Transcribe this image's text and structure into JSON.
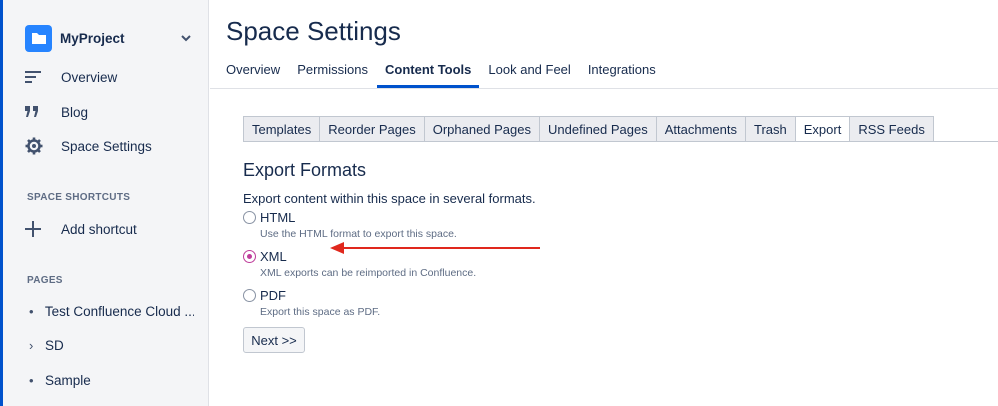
{
  "sidebar": {
    "project_name": "MyProject",
    "nav": [
      {
        "label": "Overview",
        "icon": "lines-icon"
      },
      {
        "label": "Blog",
        "icon": "quote-icon"
      },
      {
        "label": "Space Settings",
        "icon": "gear-icon"
      }
    ],
    "shortcuts_heading": "SPACE SHORTCUTS",
    "add_shortcut_label": "Add shortcut",
    "pages_heading": "PAGES",
    "pages": [
      {
        "bullet": "•",
        "label": "Test Confluence Cloud ..."
      },
      {
        "bullet": "›",
        "label": "SD"
      },
      {
        "bullet": "•",
        "label": "Sample"
      }
    ]
  },
  "main": {
    "title": "Space Settings",
    "tabs": [
      "Overview",
      "Permissions",
      "Content Tools",
      "Look and Feel",
      "Integrations"
    ],
    "active_tab": "Content Tools",
    "sub_tabs": [
      "Templates",
      "Reorder Pages",
      "Orphaned Pages",
      "Undefined Pages",
      "Attachments",
      "Trash",
      "Export",
      "RSS Feeds"
    ],
    "active_sub_tab": "Export",
    "export": {
      "heading": "Export Formats",
      "description": "Export content within this space in several formats.",
      "options": [
        {
          "label": "HTML",
          "help": "Use the HTML format to export this space.",
          "checked": false
        },
        {
          "label": "XML",
          "help": "XML exports can be reimported in Confluence.",
          "checked": true
        },
        {
          "label": "PDF",
          "help": "Export this space as PDF.",
          "checked": false
        }
      ],
      "next_label": "Next >>"
    }
  },
  "colors": {
    "brand_blue": "#0052cc",
    "logo_blue": "#2684ff",
    "radio_selected": "#bf3d9b",
    "annotation_arrow": "#e0281d"
  }
}
